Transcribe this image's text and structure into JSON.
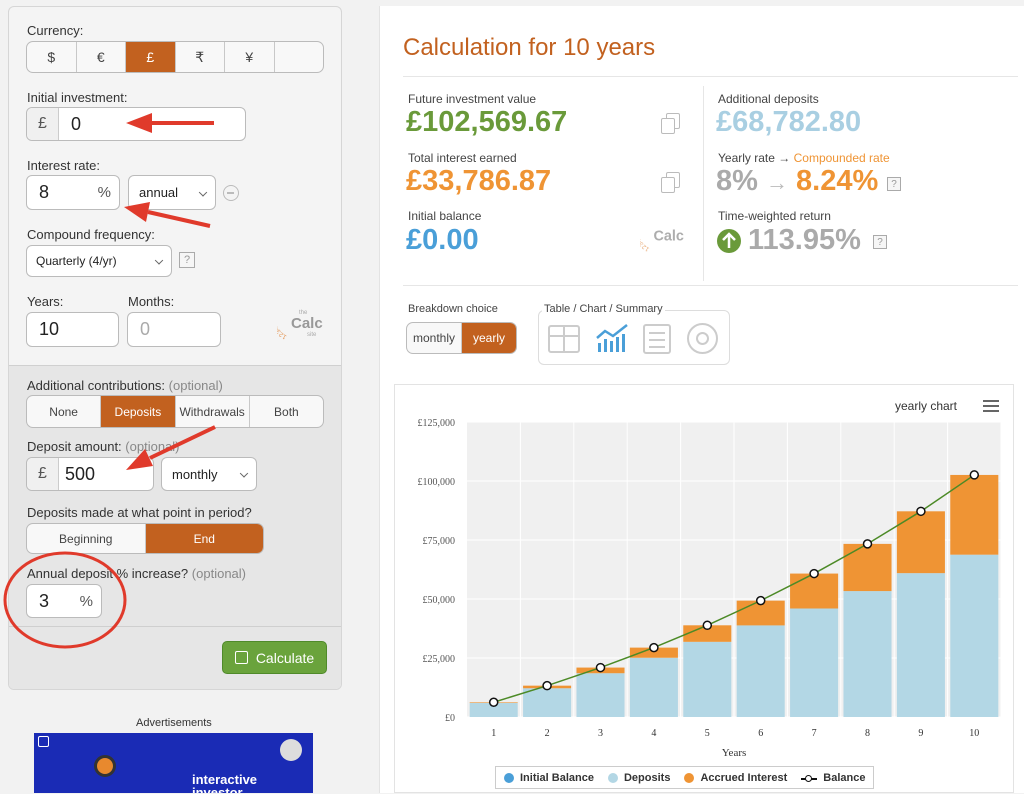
{
  "calculator": {
    "currency_label": "Currency:",
    "currencies": [
      "$",
      "€",
      "£",
      "₹",
      "¥",
      ""
    ],
    "selected_currency": "£",
    "initial_investment_label": "Initial investment:",
    "initial_investment_prefix": "£",
    "initial_investment_value": "0",
    "interest_rate_label": "Interest rate:",
    "interest_rate_value": "8",
    "interest_rate_unit": "%",
    "interest_rate_period": "annual",
    "compound_frequency_label": "Compound frequency:",
    "compound_frequency_value": "Quarterly (4/yr)",
    "help_mark": "?",
    "years_label": "Years:",
    "years_value": "10",
    "months_label": "Months:",
    "months_placeholder": "0",
    "additional_contributions_label": "Additional contributions:",
    "optional_text": "(optional)",
    "contribution_options": [
      "None",
      "Deposits",
      "Withdrawals",
      "Both"
    ],
    "selected_contribution": "Deposits",
    "deposit_amount_label": "Deposit amount:",
    "deposit_prefix": "£",
    "deposit_amount_value": "500",
    "deposit_frequency": "monthly",
    "deposit_timing_label": "Deposits made at what point in period?",
    "timing_options": [
      "Beginning",
      "End"
    ],
    "selected_timing": "End",
    "annual_increase_label": "Annual deposit % increase?",
    "annual_increase_value": "3",
    "annual_increase_unit": "%",
    "calculate_button": "Calculate",
    "ads_label": "Advertisements",
    "ad_text": "interactive investor",
    "logo_text": "the Calc site",
    "logo_digits": "1234567890"
  },
  "results": {
    "title": "Calculation for 10 years",
    "future_value_label": "Future investment value",
    "future_value": "£102,569.67",
    "additional_deposits_label": "Additional deposits",
    "additional_deposits": "£68,782.80",
    "total_interest_label": "Total interest earned",
    "total_interest": "£33,786.87",
    "yearly_rate_label": "Yearly rate",
    "arrow": "→",
    "compounded_rate_label": "Compounded rate",
    "yearly_rate": "8%",
    "compounded_rate": "8.24%",
    "initial_balance_label": "Initial balance",
    "initial_balance": "£0.00",
    "twr_label": "Time-weighted return",
    "twr_value": "113.95%",
    "breakdown_label": "Breakdown choice",
    "breakdown_options": [
      "monthly",
      "yearly"
    ],
    "selected_breakdown": "yearly",
    "view_label": "Table / Chart / Summary"
  },
  "colors": {
    "accent": "#c2611f",
    "green": "#6a9a3a",
    "light_blue": "#a9cfe2",
    "deposits_bar": "#b3d7e5",
    "interest_bar": "#ef9434",
    "balance_line": "#4c8a26",
    "annotation_red": "#e03a2b"
  },
  "chart_data": {
    "type": "bar",
    "title": "yearly chart",
    "xlabel": "Years",
    "ylabel": "",
    "categories": [
      "1",
      "2",
      "3",
      "4",
      "5",
      "6",
      "7",
      "8",
      "9",
      "10"
    ],
    "ylim": [
      0,
      125000
    ],
    "y_ticks": [
      "£0",
      "£25,000",
      "£50,000",
      "£75,000",
      "£100,000",
      "£125,000"
    ],
    "stacked": true,
    "series": [
      {
        "name": "Initial Balance",
        "kind": "bar",
        "color": "#4a9fd8",
        "values": [
          0,
          0,
          0,
          0,
          0,
          0,
          0,
          0,
          0,
          0
        ]
      },
      {
        "name": "Deposits",
        "kind": "bar",
        "color": "#b3d7e5",
        "values": [
          6000,
          12180,
          18545,
          25102,
          31855,
          38810,
          45975,
          53354,
          60955,
          68783
        ]
      },
      {
        "name": "Accrued Interest",
        "kind": "bar",
        "color": "#ef9434",
        "values": [
          250,
          1100,
          2400,
          4300,
          7000,
          10500,
          14800,
          20000,
          26200,
          33787
        ]
      },
      {
        "name": "Balance",
        "kind": "line",
        "color": "#4c8a26",
        "values": [
          6250,
          13280,
          20945,
          29402,
          38855,
          49310,
          60775,
          73354,
          87155,
          102570
        ]
      }
    ],
    "grid": true,
    "legend": "bottom"
  }
}
